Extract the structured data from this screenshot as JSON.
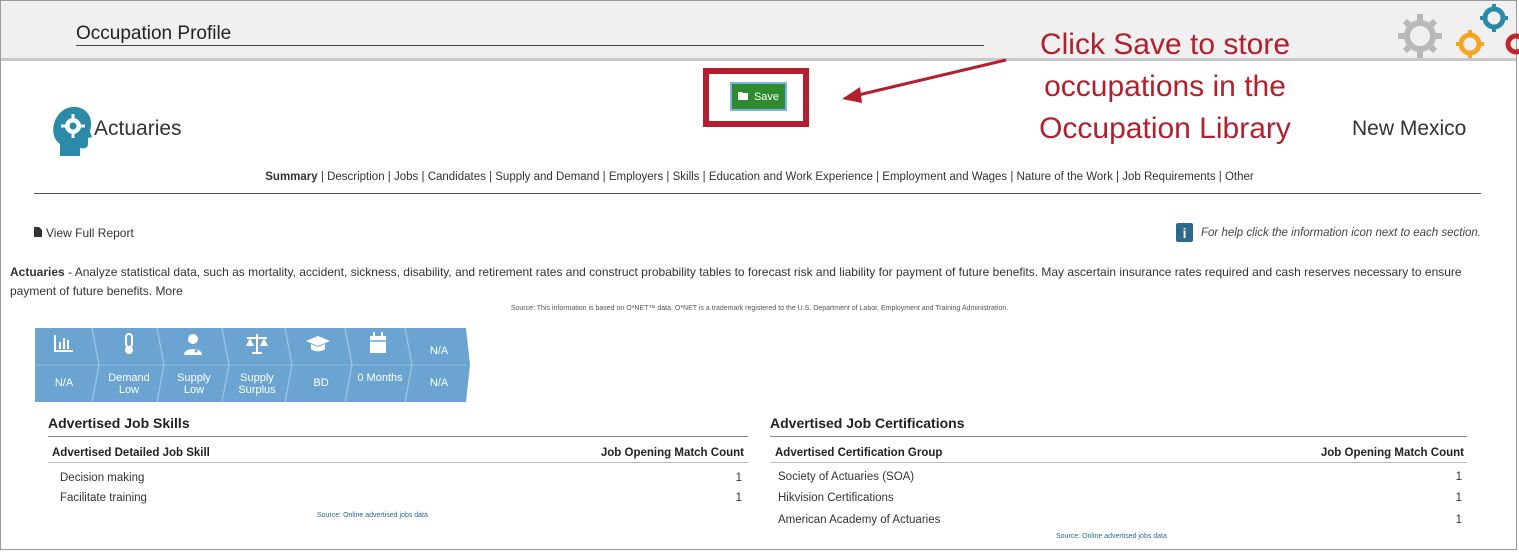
{
  "header": {
    "title": "Occupation Profile",
    "gear_icon": "gears-logo-icon"
  },
  "save_button": {
    "label": "Save",
    "icon": "folder-icon"
  },
  "callout": {
    "lines": [
      "Click Save to store",
      "occupations in the",
      "Occupation Library"
    ],
    "color": "#b21f2d"
  },
  "occupation": {
    "name": "Actuaries",
    "icon": "head-gear-icon",
    "state": "New Mexico"
  },
  "nav": {
    "items": [
      "Summary",
      "Description",
      "Jobs",
      "Candidates",
      "Supply and Demand",
      "Employers",
      "Skills",
      "Education and Work Experience",
      "Employment and Wages",
      "Nature of the Work",
      "Job Requirements",
      "Other"
    ],
    "selected": "Summary"
  },
  "view_full_report": "View Full Report",
  "help_text": "For help click the information icon next to each section.",
  "description": {
    "term": "Actuaries",
    "text": " - Analyze statistical data, such as mortality, accident, sickness, disability, and retirement rates and construct probability tables to forecast risk and liability for payment of future benefits. May ascertain insurance rates required and cash reserves necessary to ensure payment of future benefits.",
    "more": "More"
  },
  "source_onet": "Source: This information is based on O*NET™ data. O*NET is a trademark registered to the U.S. Department of Labor, Employment and Training Administration.",
  "tiles": [
    {
      "icon": "bar-chart-icon",
      "label": "N/A"
    },
    {
      "icon": "thermometer-icon",
      "label": "Demand Low"
    },
    {
      "icon": "doctor-icon",
      "label": "Supply Low"
    },
    {
      "icon": "scale-icon",
      "label": "Supply Surplus"
    },
    {
      "icon": "graduation-cap-icon",
      "label": "BD"
    },
    {
      "icon": "calendar-icon",
      "label": "0 Months"
    },
    {
      "icon": "",
      "top_label": "N/A",
      "label": "N/A"
    }
  ],
  "skills": {
    "title": "Advertised Job Skills",
    "col1": "Advertised Detailed Job Skill",
    "col2": "Job Opening Match Count",
    "rows": [
      {
        "name": "Decision making",
        "count": "1"
      },
      {
        "name": "Facilitate training",
        "count": "1"
      }
    ],
    "source": "Source: Online advertised jobs data"
  },
  "certs": {
    "title": "Advertised Job Certifications",
    "col1": "Advertised Certification Group",
    "col2": "Job Opening Match Count",
    "rows": [
      {
        "name": "Society of Actuaries (SOA)",
        "count": "1"
      },
      {
        "name": "Hikvision Certifications",
        "count": "1"
      },
      {
        "name": "American Academy of Actuaries",
        "count": "1"
      }
    ],
    "source": "Source: Online advertised jobs data"
  }
}
